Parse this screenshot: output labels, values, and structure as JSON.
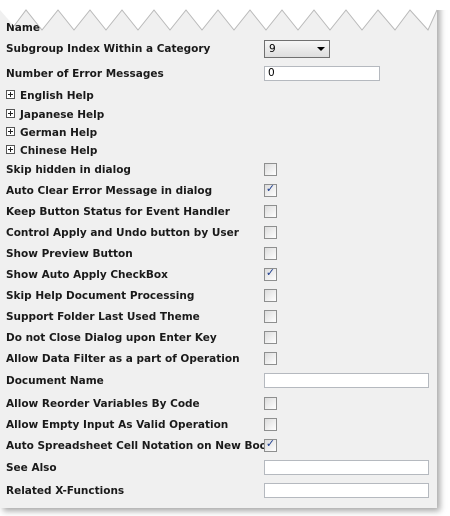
{
  "top_label": "Name",
  "subgroup": {
    "label": "Subgroup Index Within a Category",
    "value": "9"
  },
  "error_messages": {
    "label": "Number of Error Messages",
    "value": "0"
  },
  "help_groups": [
    "English Help",
    "Japanese Help",
    "German Help",
    "Chinese Help"
  ],
  "options": [
    {
      "label": "Skip hidden in dialog",
      "checked": false
    },
    {
      "label": "Auto Clear Error Message in dialog",
      "checked": true
    },
    {
      "label": "Keep Button Status for Event Handler",
      "checked": false
    },
    {
      "label": "Control Apply and Undo button by User",
      "checked": false
    },
    {
      "label": "Show Preview Button",
      "checked": false
    },
    {
      "label": "Show Auto Apply CheckBox",
      "checked": true
    },
    {
      "label": "Skip Help Document Processing",
      "checked": false
    },
    {
      "label": "Support Folder Last Used Theme",
      "checked": false
    },
    {
      "label": "Do not Close Dialog upon Enter Key",
      "checked": false
    },
    {
      "label": "Allow Data Filter as a part of Operation",
      "checked": false
    }
  ],
  "document_name": {
    "label": "Document Name",
    "value": ""
  },
  "options2": [
    {
      "label": "Allow Reorder Variables By Code",
      "checked": false
    },
    {
      "label": "Allow Empty Input As Valid Operation",
      "checked": false
    },
    {
      "label": "Auto Spreadsheet Cell Notation on New Book",
      "checked": true
    }
  ],
  "see_also": {
    "label": "See Also",
    "value": ""
  },
  "related": {
    "label": "Related X-Functions",
    "value": ""
  },
  "check_glyph": "✓"
}
